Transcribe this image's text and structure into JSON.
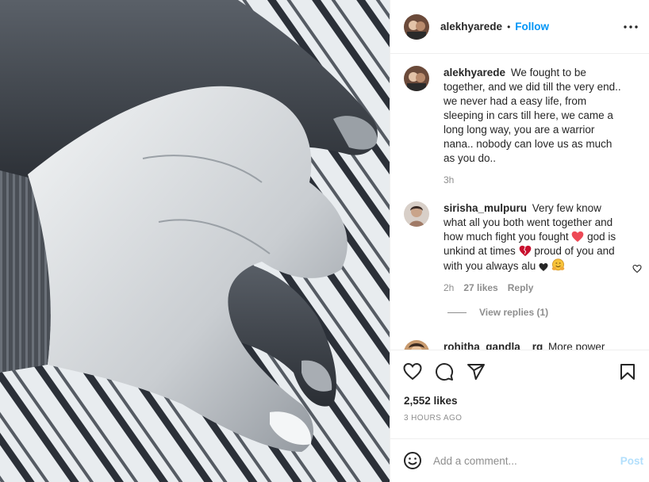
{
  "post": {
    "username": "alekhyarede",
    "separator": "•",
    "follow_label": "Follow"
  },
  "caption": {
    "username": "alekhyarede",
    "text": "We fought to be together, and we did till the very end.. we never had a easy life, from sleeping in cars till here, we came a long long way, you are a warrior nana.. nobody can love us as much as you do..",
    "time": "3h"
  },
  "comments": [
    {
      "username": "sirisha_mulpuru",
      "text_1": "Very few know what all you both went together and how much fight you fought",
      "text_2": "god is unkind at times",
      "text_3": "proud of you and with you always alu",
      "time": "2h",
      "likes": "27 likes",
      "reply_label": "Reply",
      "view_replies": "View replies (1)"
    },
    {
      "username": "rohitha_gandla__rg",
      "text": "More power"
    }
  ],
  "actions": {
    "likes": "2,552 likes",
    "timestamp": "3 HOURS AGO"
  },
  "add_comment": {
    "placeholder": "Add a comment...",
    "post_label": "Post"
  },
  "colors": {
    "accent": "#0095f6",
    "post_disabled": "#b2dffc",
    "heart_red": "#ed4956",
    "muted": "#8e8e8e"
  }
}
